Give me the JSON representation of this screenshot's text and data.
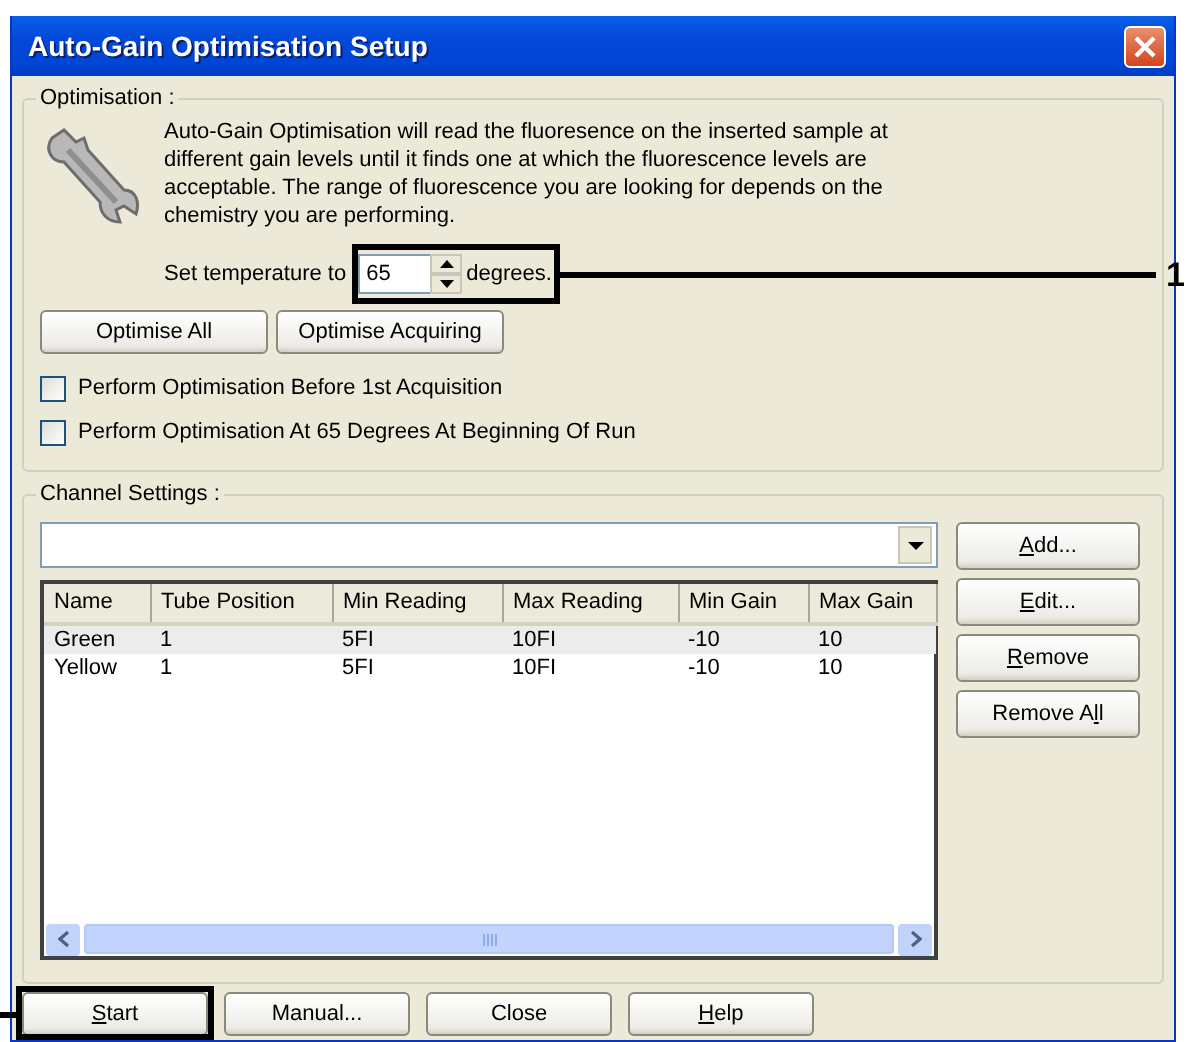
{
  "window": {
    "title": "Auto-Gain Optimisation Setup"
  },
  "optimisation": {
    "legend": "Optimisation :",
    "description": "Auto-Gain Optimisation will read the fluoresence on the inserted sample at different gain levels until it finds one at which the fluorescence levels are acceptable. The range of fluorescence you are looking for depends on the chemistry you are performing.",
    "temperature_label": "Set temperature to",
    "temperature_value": "65",
    "temperature_unit": "degrees.",
    "buttons": [
      "Optimise All",
      "Optimise Acquiring"
    ],
    "checkboxes": [
      {
        "label": "Perform Optimisation Before 1st Acquisition",
        "checked": false
      },
      {
        "label": "Perform Optimisation At 65 Degrees At Beginning Of Run",
        "checked": false
      }
    ]
  },
  "channel_settings": {
    "legend": "Channel Settings :",
    "columns": [
      "Name",
      "Tube Position",
      "Min Reading",
      "Max Reading",
      "Min Gain",
      "Max Gain"
    ],
    "rows": [
      {
        "cells": [
          "Green",
          "1",
          "5FI",
          "10FI",
          "-10",
          "10"
        ],
        "selected": true
      },
      {
        "cells": [
          "Yellow",
          "1",
          "5FI",
          "10FI",
          "-10",
          "10"
        ],
        "selected": false
      }
    ],
    "buttons": [
      {
        "key": "A",
        "post": "dd..."
      },
      {
        "key": "E",
        "post": "dit..."
      },
      {
        "key": "R",
        "post": "emove"
      },
      {
        "pre": "Remove A",
        "key": "l",
        "post": "l"
      }
    ]
  },
  "footer_buttons": [
    {
      "key": "S",
      "post": "tart"
    },
    {
      "pre": "Manual..."
    },
    {
      "pre": "Close"
    },
    {
      "key": "H",
      "post": "elp"
    }
  ],
  "annotations": [
    {
      "label": "1"
    }
  ]
}
